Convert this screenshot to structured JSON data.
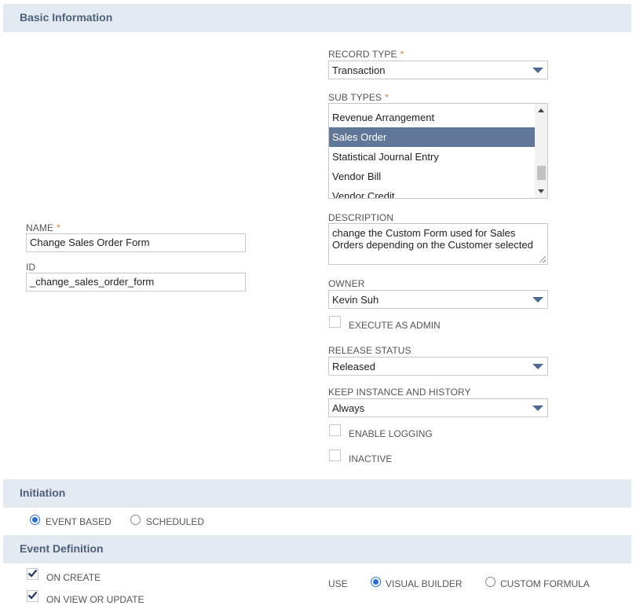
{
  "sections": {
    "basic_information": "Basic Information",
    "initiation": "Initiation",
    "event_definition": "Event Definition"
  },
  "fields": {
    "name": {
      "label": "NAME",
      "required": "*",
      "value": "Change Sales Order Form"
    },
    "id": {
      "label": "ID",
      "value": "_change_sales_order_form"
    },
    "record_type": {
      "label": "RECORD TYPE",
      "required": "*",
      "value": "Transaction"
    },
    "sub_types": {
      "label": "SUB TYPES",
      "required": "*",
      "options": [
        "Revenue Arrangement",
        "Sales Order",
        "Statistical Journal Entry",
        "Vendor Bill",
        "Vendor Credit"
      ],
      "selected": "Sales Order"
    },
    "description": {
      "label": "DESCRIPTION",
      "value": "change the Custom Form used for Sales Orders depending on the Customer selected"
    },
    "owner": {
      "label": "OWNER",
      "value": "Kevin Suh"
    },
    "execute_as_admin": {
      "label": "EXECUTE AS ADMIN",
      "checked": false
    },
    "release_status": {
      "label": "RELEASE STATUS",
      "value": "Released"
    },
    "keep_instance": {
      "label": "KEEP INSTANCE AND HISTORY",
      "value": "Always"
    },
    "enable_logging": {
      "label": "ENABLE LOGGING",
      "checked": false
    },
    "inactive": {
      "label": "INACTIVE",
      "checked": false
    }
  },
  "initiation": {
    "event_based": {
      "label": "EVENT BASED",
      "selected": true
    },
    "scheduled": {
      "label": "SCHEDULED",
      "selected": false
    }
  },
  "event_definition": {
    "on_create": {
      "label": "ON CREATE",
      "checked": true
    },
    "on_view_or_update": {
      "label": "ON VIEW OR UPDATE",
      "checked": true
    },
    "use_label": "USE",
    "visual_builder": {
      "label": "VISUAL BUILDER",
      "selected": true
    },
    "custom_formula": {
      "label": "CUSTOM FORMULA",
      "selected": false
    }
  },
  "colors": {
    "section_bg": "#e3e9f1",
    "section_title": "#4d5f79",
    "selected_option": "#607799",
    "required": "#e07b2b",
    "radio_active": "#2b6fd6"
  }
}
